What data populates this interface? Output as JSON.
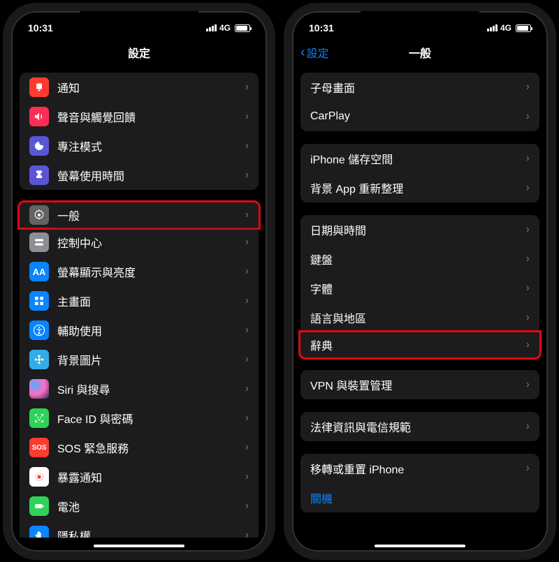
{
  "statusBar": {
    "time": "10:31",
    "network": "4G"
  },
  "phone1": {
    "title": "設定",
    "sections": [
      {
        "rows": [
          {
            "id": "notifications",
            "label": "通知",
            "iconClass": "ic-red",
            "icon": "bell-icon"
          },
          {
            "id": "sounds",
            "label": "聲音與觸覺回饋",
            "iconClass": "ic-redpink",
            "icon": "speaker-icon"
          },
          {
            "id": "focus",
            "label": "專注模式",
            "iconClass": "ic-purple",
            "icon": "moon-icon"
          },
          {
            "id": "screentime",
            "label": "螢幕使用時間",
            "iconClass": "ic-indigo",
            "icon": "hourglass-icon"
          }
        ]
      },
      {
        "rows": [
          {
            "id": "general",
            "label": "一般",
            "iconClass": "ic-darkgray",
            "icon": "gear-icon",
            "highlight": true
          },
          {
            "id": "controlcenter",
            "label": "控制中心",
            "iconClass": "ic-gray",
            "icon": "toggles-icon"
          },
          {
            "id": "display",
            "label": "螢幕顯示與亮度",
            "iconClass": "ic-blue",
            "icon": "text-size-icon"
          },
          {
            "id": "homescreen",
            "label": "主畫面",
            "iconClass": "ic-blue",
            "icon": "grid-icon"
          },
          {
            "id": "accessibility",
            "label": "輔助使用",
            "iconClass": "ic-access",
            "icon": "accessibility-icon"
          },
          {
            "id": "wallpaper",
            "label": "背景圖片",
            "iconClass": "ic-teal",
            "icon": "flower-icon"
          },
          {
            "id": "siri",
            "label": "Siri 與搜尋",
            "iconClass": "ic-siri",
            "icon": "siri-icon"
          },
          {
            "id": "faceid",
            "label": "Face ID 與密碼",
            "iconClass": "ic-green",
            "icon": "faceid-icon"
          },
          {
            "id": "sos",
            "label": "SOS 緊急服務",
            "iconClass": "ic-sos",
            "icon": "sos-icon",
            "iconText": "SOS"
          },
          {
            "id": "exposure",
            "label": "暴露通知",
            "iconClass": "ic-white",
            "icon": "exposure-icon"
          },
          {
            "id": "battery",
            "label": "電池",
            "iconClass": "ic-green",
            "icon": "battery-icon"
          },
          {
            "id": "privacy",
            "label": "隱私權",
            "iconClass": "ic-blue",
            "icon": "hand-icon"
          }
        ]
      }
    ]
  },
  "phone2": {
    "title": "一般",
    "backLabel": "設定",
    "sections": [
      {
        "partial": true,
        "rows": [
          {
            "id": "handoff",
            "label": "子母畫面"
          },
          {
            "id": "carplay",
            "label": "CarPlay"
          }
        ]
      },
      {
        "rows": [
          {
            "id": "storage",
            "label": "iPhone 儲存空間"
          },
          {
            "id": "bgrefresh",
            "label": "背景 App 重新整理"
          }
        ]
      },
      {
        "rows": [
          {
            "id": "datetime",
            "label": "日期與時間"
          },
          {
            "id": "keyboard",
            "label": "鍵盤"
          },
          {
            "id": "fonts",
            "label": "字體"
          },
          {
            "id": "language",
            "label": "語言與地區"
          },
          {
            "id": "dictionary",
            "label": "辭典",
            "highlight": true
          }
        ]
      },
      {
        "rows": [
          {
            "id": "vpn",
            "label": "VPN 與裝置管理"
          }
        ]
      },
      {
        "rows": [
          {
            "id": "legal",
            "label": "法律資訊與電信規範"
          }
        ]
      },
      {
        "rows": [
          {
            "id": "reset",
            "label": "移轉或重置 iPhone"
          },
          {
            "id": "shutdown",
            "label": "關機",
            "noChevron": true,
            "blue": true
          }
        ]
      }
    ]
  }
}
